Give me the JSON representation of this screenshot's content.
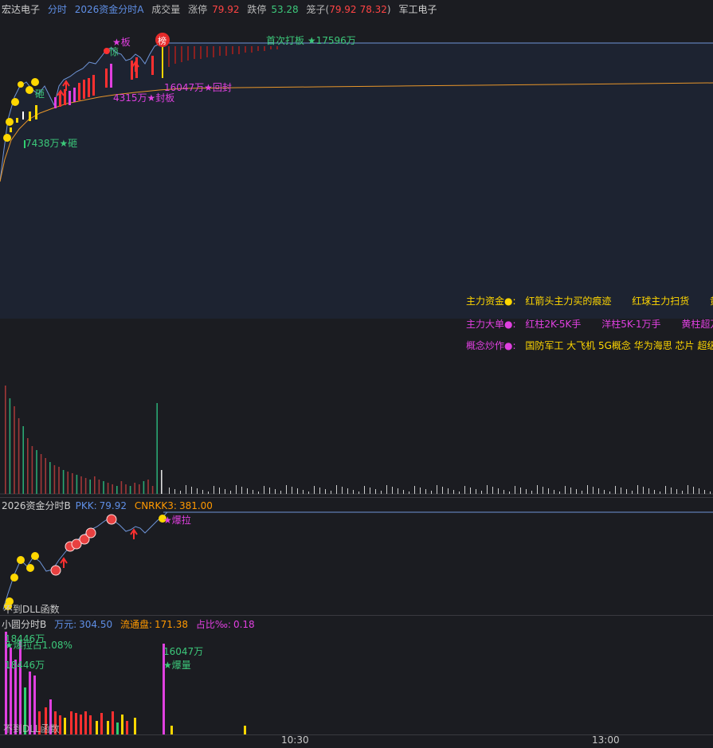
{
  "main_header": {
    "stock_name": "宏达电子",
    "view": "分时",
    "indicator": "2026资金分时A",
    "volume_label": "成交量",
    "limit_up_label": "涨停",
    "limit_up_value": "79.92",
    "limit_down_label": "跌停",
    "limit_down_value": "53.28",
    "cage_label": "笼子(",
    "cage_high": "79.92",
    "cage_low": "78.32",
    "cage_close": ")",
    "sector": "军工电子"
  },
  "annotations": {
    "board": "★板",
    "jing": "惊",
    "limit_badge": "榜",
    "first_board": "首次打板 ★17596万",
    "re_seal": "16047万★回封",
    "seal": "4315万★封板",
    "za_top": "砸",
    "za_bottom": "7438万★砸"
  },
  "legend": {
    "row1_title": "主力资金●:",
    "row1_items": [
      "红箭头主力买的痕迹",
      "红球主力扫货",
      "黄"
    ],
    "row2_title": "主力大单●:",
    "row2_items": [
      "红柱2K-5K手",
      "洋柱5K-1万手",
      "黄柱超万"
    ],
    "row3_title": "概念炒作●:",
    "row3_text": "国防军工 大飞机 5G概念 华为海思 芯片 超级"
  },
  "panel_b": {
    "title": "2026资金分时B",
    "pkk_label": "PKK:",
    "pkk_value": "79.92",
    "cnrkk_label": "CNRKK3:",
    "cnrkk_value": "381.00",
    "burst_label": "★爆拉",
    "dll_text": "不到DLL函数"
  },
  "panel_c": {
    "title": "小圆分时B",
    "wanyuan_label": "万元:",
    "wanyuan_value": "304.50",
    "float_label": "流通盘:",
    "float_value": "171.38",
    "ratio_label": "占比‰:",
    "ratio_value": "0.18",
    "label_amount1": "18446万",
    "label_burst_ratio": "★爆拉占1.08%",
    "label_amount2": "18446万",
    "label_amount3": "16047万",
    "label_burst_vol": "★爆量",
    "dll_text": "不到DLL函数"
  },
  "time_axis": [
    "10:30",
    "13:00"
  ],
  "colors": {
    "price_line": "#6f95d8",
    "avg_line": "#e8962a",
    "up": "#ff3030",
    "down": "#30d070",
    "magenta": "#e040e0",
    "yellow": "#ffd700"
  }
}
